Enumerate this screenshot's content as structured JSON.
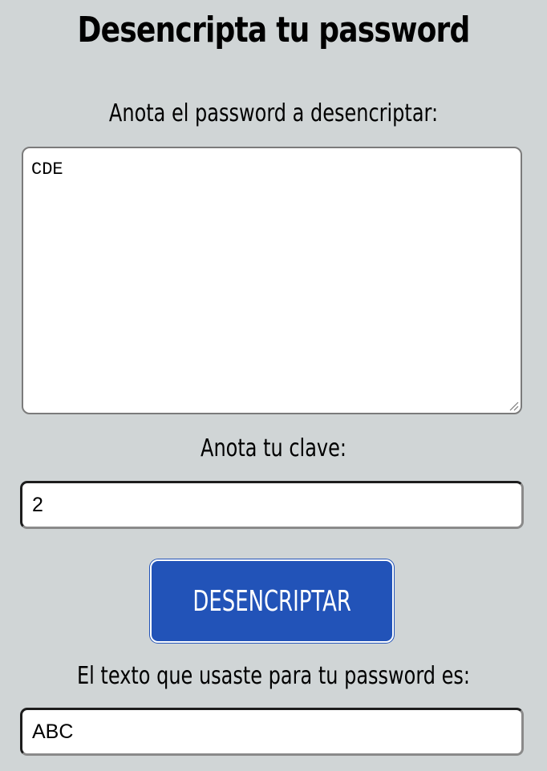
{
  "header": {
    "title": "Desencripta tu password"
  },
  "form": {
    "password_label": "Anota el password a desencriptar:",
    "password_value": "CDE",
    "key_label": "Anota tu clave:",
    "key_value": "2",
    "decrypt_button_label": "DESENCRIPTAR",
    "result_label": "El texto que usaste para tu password es:",
    "result_value": "ABC"
  },
  "colors": {
    "page_background": "#d0d5d6",
    "button_background": "#2253b8",
    "button_text": "#ffffff"
  }
}
